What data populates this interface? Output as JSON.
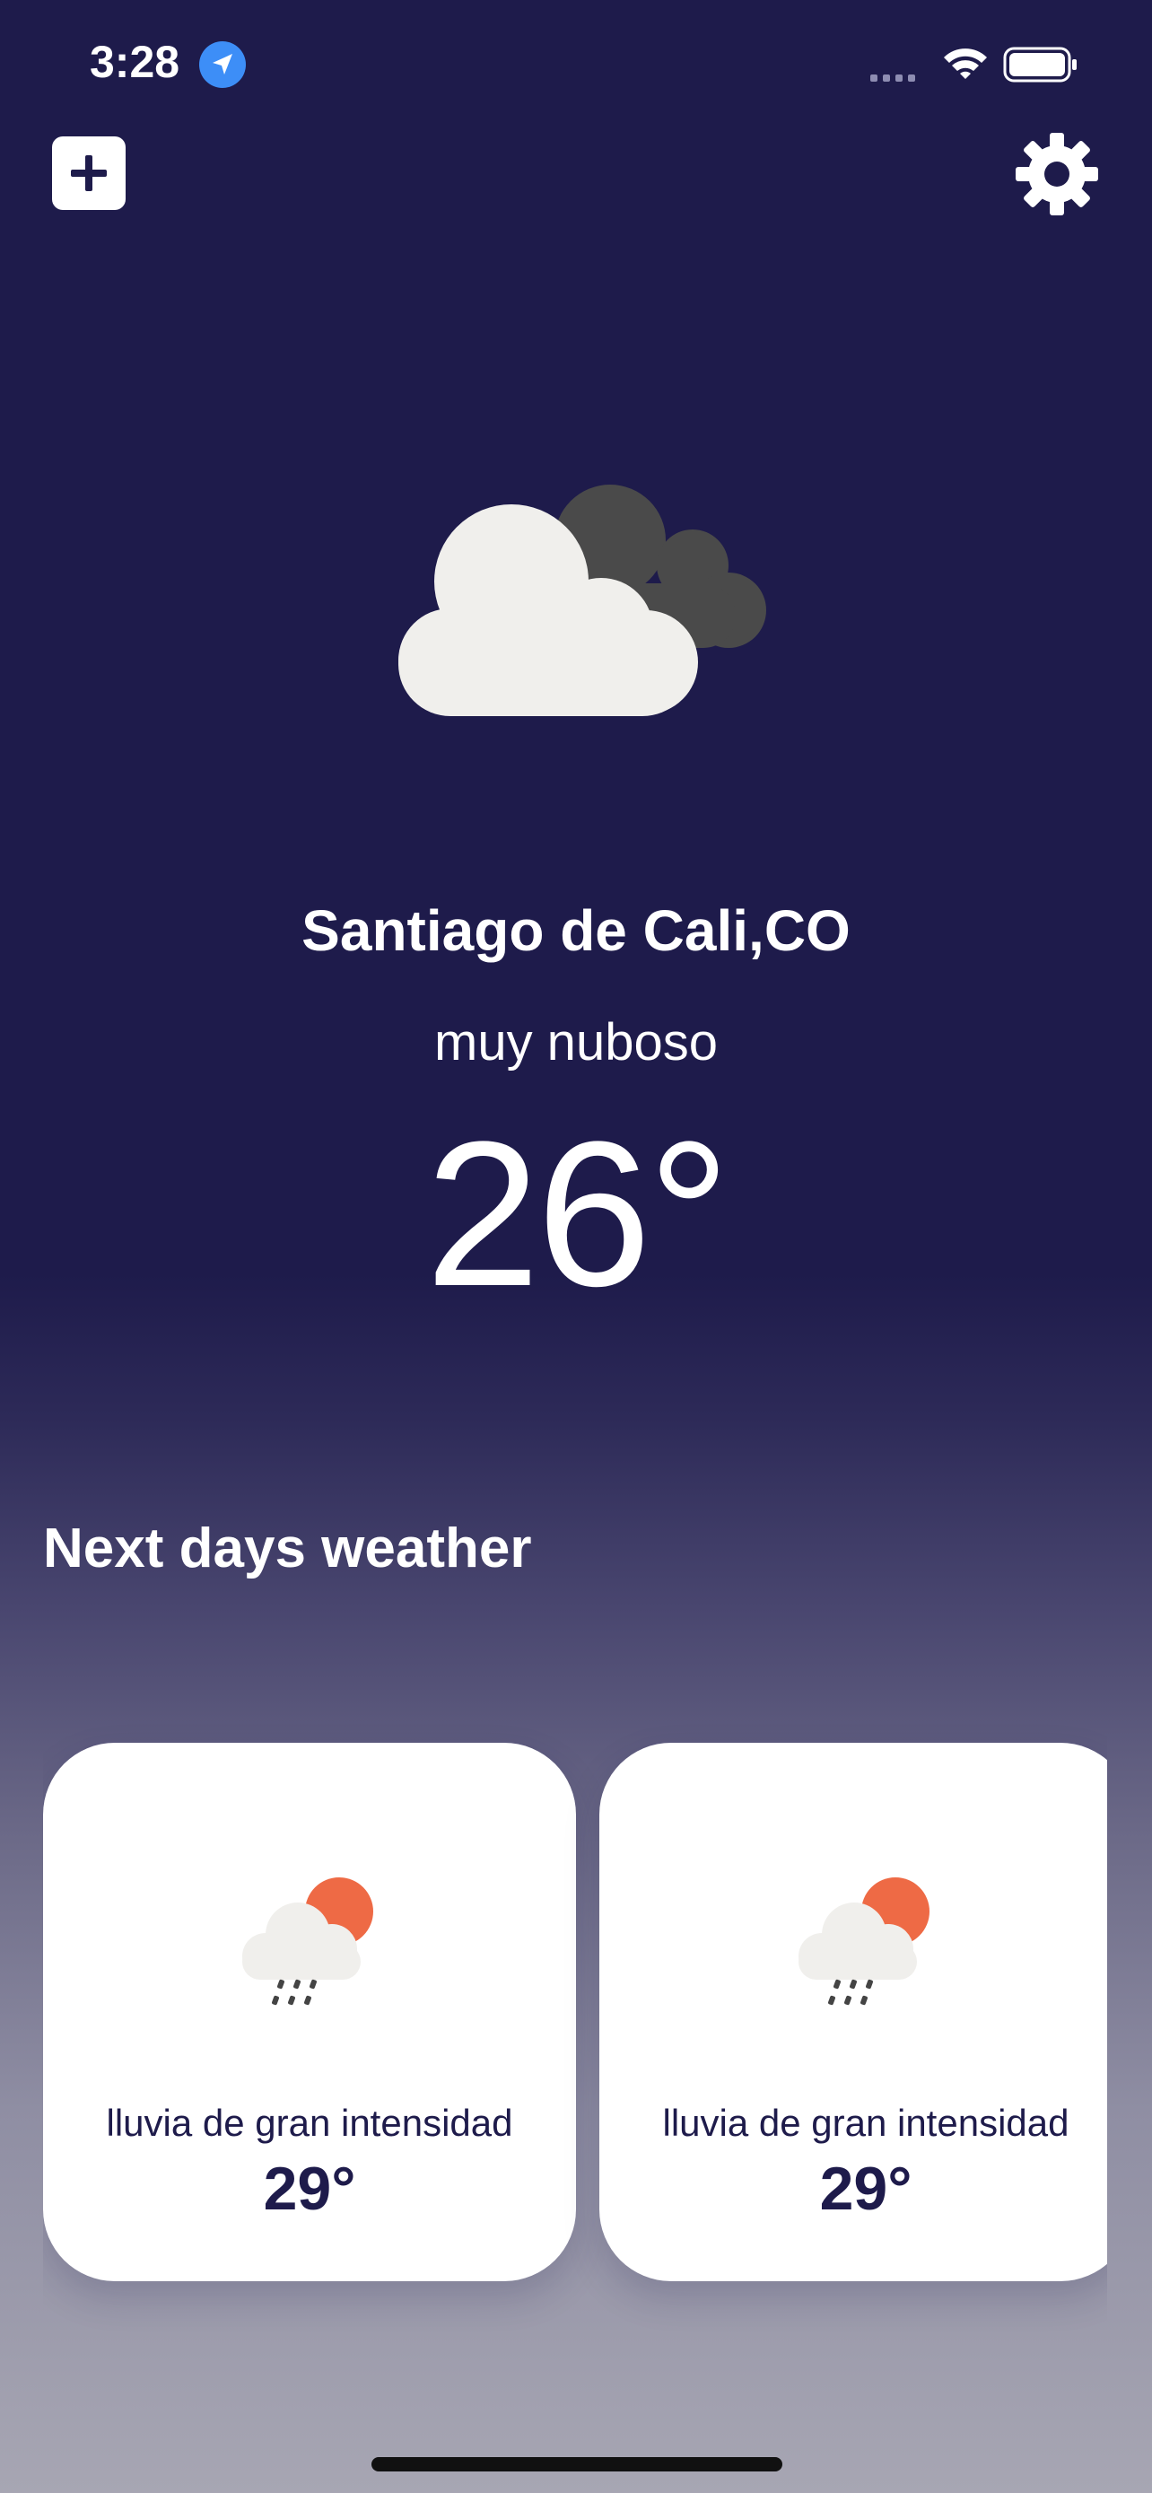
{
  "status_bar": {
    "time": "3:28",
    "icons": [
      "location-arrow-icon",
      "signal-icon",
      "wifi-icon",
      "battery-icon"
    ]
  },
  "toolbar": {
    "add_icon": "plus-icon",
    "settings_icon": "gear-icon"
  },
  "current": {
    "icon": "cloudy-icon",
    "city": "Santiago de Cali,CO",
    "description": "muy nuboso",
    "temperature": "26°"
  },
  "forecast": {
    "title": "Next days weather",
    "cards": [
      {
        "icon": "rain-sun-icon",
        "description": "lluvia de gran intensidad",
        "temperature": "29°"
      },
      {
        "icon": "rain-sun-icon",
        "description": "lluvia de gran intensidad",
        "temperature": "29°"
      }
    ]
  },
  "colors": {
    "background": "#1e1b4b",
    "card": "#ffffff",
    "text_dark": "#1e1b4b",
    "sun": "#ee6a45",
    "cloud_light": "#f0efec",
    "cloud_dark": "#4a4a4a",
    "location_badge": "#3d8ef7"
  }
}
